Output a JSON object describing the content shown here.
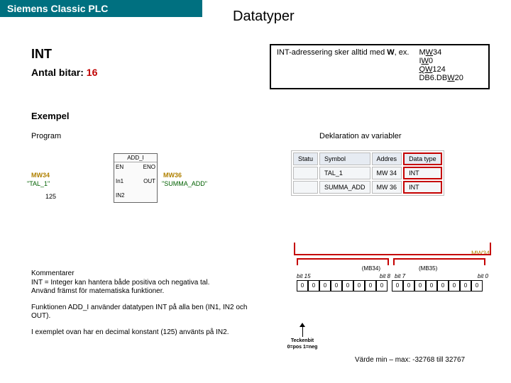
{
  "header": {
    "brand": "Siemens Classic PLC"
  },
  "page": {
    "title": "Datatyper"
  },
  "type": {
    "name": "INT",
    "bits_label": "Antal bitar:",
    "bits_value": "16"
  },
  "addr": {
    "text_prefix": "INT-adressering sker alltid med ",
    "w": "W",
    "text_suffix": ", ex.",
    "examples": [
      "MW34",
      "IW0",
      "QW124",
      "DB6.DBW20"
    ]
  },
  "labels": {
    "exempel": "Exempel",
    "program": "Program",
    "variables": "Deklaration av variabler"
  },
  "fbd": {
    "block": "ADD_I",
    "ports": {
      "en": "EN",
      "eno": "ENO",
      "in1": "In1",
      "in2": "IN2",
      "out": "OUT"
    },
    "sig": {
      "mw34": "MW34",
      "mw36": "MW36",
      "tal1": "\"TAL_1\"",
      "summa": "\"SUMMA_ADD\"",
      "const125": "125"
    }
  },
  "symtab": {
    "headers": [
      "Statu",
      "Symbol",
      "Addres",
      "Data type"
    ],
    "rows": [
      [
        "",
        "TAL_1",
        "MW   34",
        "INT"
      ],
      [
        "",
        "SUMMA_ADD",
        "MW   36",
        "INT"
      ]
    ]
  },
  "comments": {
    "p1a": "Kommentarer",
    "p1b": "INT = Integer kan hantera både positiva och negativa tal.",
    "p1c": "Använd främst för matematiska funktioner.",
    "p2": "Funktionen ADD_I använder datatypen INT på alla ben (IN1, IN2 och OUT).",
    "p3": "I exemplet ovan har en decimal konstant (125) använts på IN2."
  },
  "bits": {
    "mw34": "MW34",
    "mb34": "(MB34)",
    "mb35": "(MB35)",
    "bit15": "bit 15",
    "bit8": "bit 8",
    "bit7": "bit 7",
    "bit0": "bit 0",
    "cell": "0",
    "sign_l1": "Teckenbit",
    "sign_l2": "0=pos 1=neg"
  },
  "range": "Värde min – max: -32768 till 32767"
}
